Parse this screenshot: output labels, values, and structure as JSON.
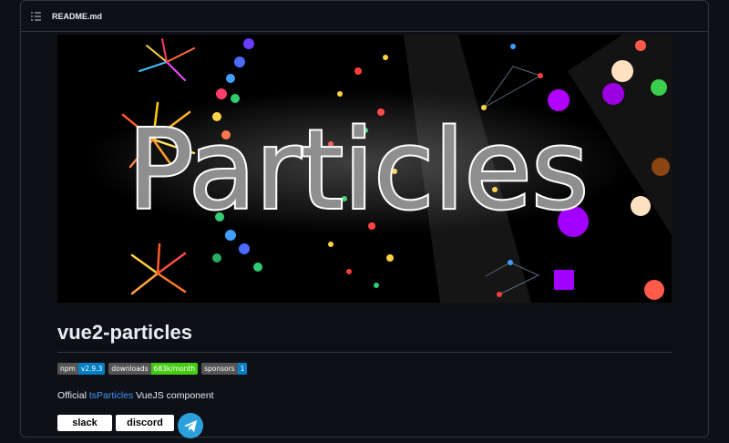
{
  "file": {
    "name": "README.md",
    "icon": "list-icon"
  },
  "banner": {
    "alt_title": "Particles"
  },
  "heading": "vue2-particles",
  "badges": [
    {
      "label": "npm",
      "value": "v2.9.3",
      "color": "#007ec6"
    },
    {
      "label": "downloads",
      "value": "683k/month",
      "color": "#4c1"
    },
    {
      "label": "sponsors",
      "value": "1",
      "color": "#007ec6"
    }
  ],
  "description": {
    "before": "Official ",
    "link": "tsParticles",
    "after": " VueJS component"
  },
  "social": {
    "slack": "slack",
    "discord": "discord",
    "telegram_icon": "telegram-icon"
  }
}
